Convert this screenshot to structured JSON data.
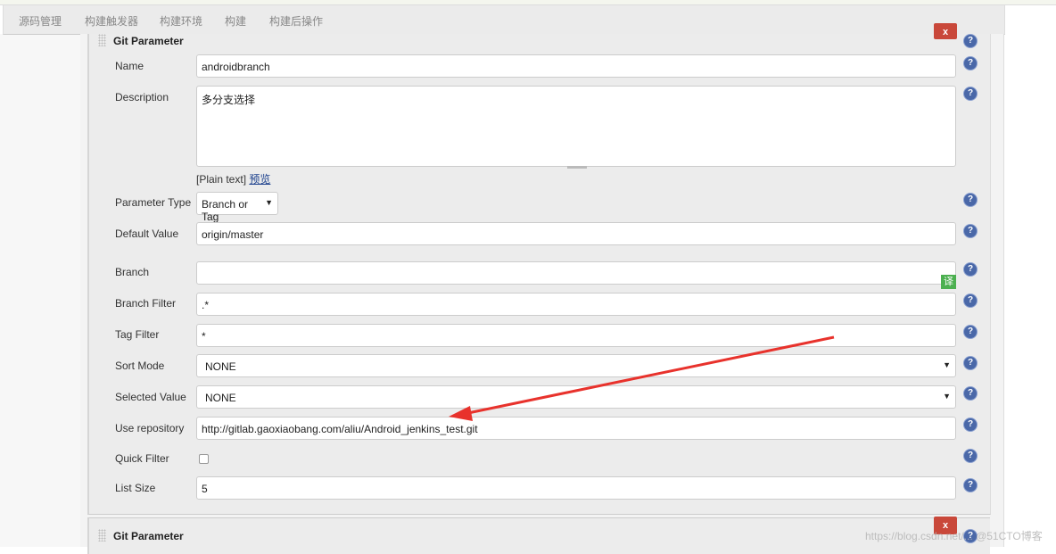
{
  "tabs": [
    "源码管理",
    "构建触发器",
    "构建环境",
    "构建",
    "构建后操作"
  ],
  "section": {
    "title": "Git Parameter",
    "delete_label": "x"
  },
  "fields": {
    "name": {
      "label": "Name",
      "value": "androidbranch"
    },
    "description": {
      "label": "Description",
      "value": "多分支选择",
      "format": "[Plain text]",
      "preview": "预览"
    },
    "parameter_type": {
      "label": "Parameter Type",
      "value": "Branch or Tag"
    },
    "default_value": {
      "label": "Default Value",
      "value": "origin/master"
    },
    "branch": {
      "label": "Branch",
      "value": ""
    },
    "branch_filter": {
      "label": "Branch Filter",
      "value": ".*"
    },
    "tag_filter": {
      "label": "Tag Filter",
      "value": "*"
    },
    "sort_mode": {
      "label": "Sort Mode",
      "value": "NONE"
    },
    "selected_value": {
      "label": "Selected Value",
      "value": "NONE"
    },
    "use_repository": {
      "label": "Use repository",
      "value": "http://gitlab.gaoxiaobang.com/aliu/Android_jenkins_test.git"
    },
    "quick_filter": {
      "label": "Quick Filter",
      "checked": false
    },
    "list_size": {
      "label": "List Size",
      "value": "5"
    }
  },
  "translate_badge": "译",
  "section2": {
    "title": "Git Parameter",
    "delete_label": "x"
  },
  "watermark": "https://blog.csdn.net/... @51CTO博客",
  "colors": {
    "delete": "#c9483a",
    "help": "#4a68a8",
    "arrow": "#e8322c",
    "translate": "#4cb050"
  }
}
